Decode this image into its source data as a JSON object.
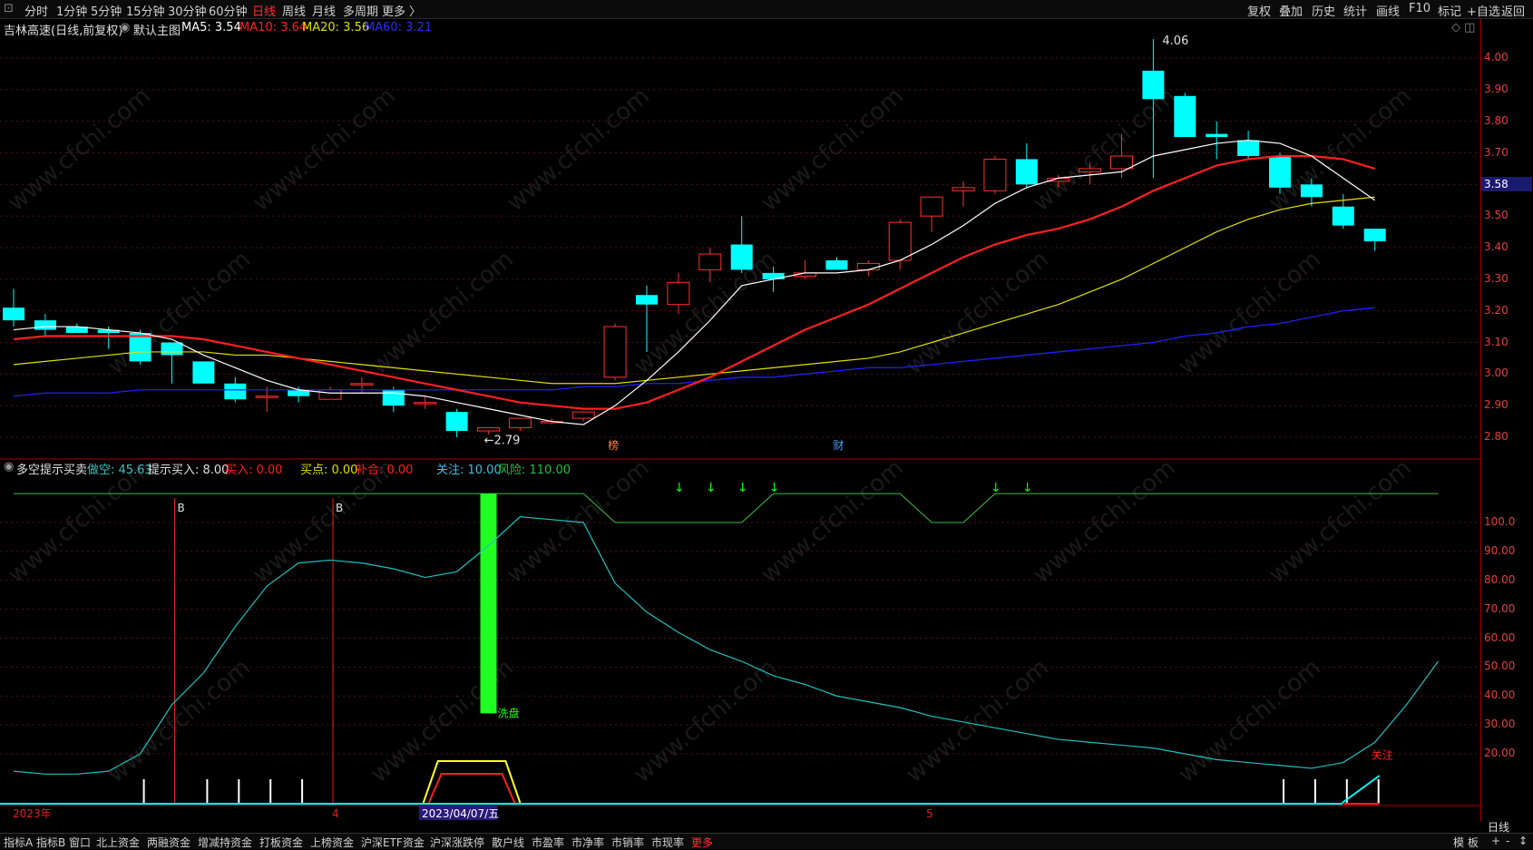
{
  "topbar": {
    "window_glyph": "⊡",
    "periods": [
      "分时",
      "1分钟",
      "5分钟",
      "15分钟",
      "30分钟",
      "60分钟",
      "日线",
      "周线",
      "月线",
      "多周期",
      "更多 〉"
    ],
    "right_buttons": [
      "复权",
      "叠加",
      "历史",
      "统计",
      "画线",
      "F10",
      "标记",
      "+自选",
      "返回"
    ]
  },
  "main_header": {
    "stock": "吉林高速(日线,前复权)",
    "chart_name": "默认主图",
    "ma5": "MA5: 3.54",
    "ma10": "MA10: 3.64",
    "ma20": "MA20: 3.56",
    "ma60": "MA60: 3.21"
  },
  "sub_header": {
    "indicator": "多空提示买卖",
    "zuokong": "做空: 45.63",
    "tishi": "提示买入: 8.00",
    "mairu": "买入: 0.00",
    "maidian": "买点: 0.00",
    "buhe": "补合: 0.00",
    "guanzhu": "关注: 10.00",
    "fengxian": "风险: 110.00"
  },
  "axis": {
    "price_ticks": [
      "4.00",
      "3.90",
      "3.80",
      "3.70",
      "3.60",
      "3.50",
      "3.40",
      "3.30",
      "3.20",
      "3.10",
      "3.00",
      "2.90",
      "2.80"
    ],
    "indicator_ticks": [
      "100.0",
      "90.00",
      "80.00",
      "70.00",
      "60.00",
      "50.00",
      "40.00",
      "30.00",
      "20.00"
    ],
    "current_price": "3.58",
    "period_label": "日线"
  },
  "annotations": {
    "high": "4.06",
    "low": "←2.79",
    "bang": "榜",
    "cai": "财",
    "b1": "B",
    "b2": "B",
    "xipan": "洗盘",
    "guanzhu": "关注",
    "date_2023": "2023年",
    "month4": "4",
    "date_cursor": "2023/04/07/五",
    "month5": "5"
  },
  "bottombar": {
    "tabs": [
      "指标A",
      "指标B",
      "窗口",
      "北上资金",
      "两融资金",
      "增减持资金",
      "打板资金",
      "上榜资金",
      "沪深ETF资金",
      "沪深涨跌停",
      "散户线",
      "市盈率",
      "市净率",
      "市销率",
      "市现率",
      "更多"
    ],
    "right": [
      "模 板",
      "+",
      "-",
      "↕"
    ]
  },
  "watermark": "www.cfchi.com",
  "colors": {
    "up": "#ff3030",
    "down": "#00ffff",
    "ma5": "#ffffff",
    "ma10": "#ff2020",
    "ma20": "#e0e000",
    "ma60": "#2020ff",
    "signal": "#00ff00"
  },
  "chart_data": {
    "type": "candlestick",
    "ylim": [
      2.75,
      4.1
    ],
    "candles": [
      {
        "o": 3.21,
        "h": 3.27,
        "l": 3.15,
        "c": 3.17
      },
      {
        "o": 3.17,
        "h": 3.19,
        "l": 3.12,
        "c": 3.14
      },
      {
        "o": 3.15,
        "h": 3.16,
        "l": 3.13,
        "c": 3.13
      },
      {
        "o": 3.14,
        "h": 3.15,
        "l": 3.08,
        "c": 3.13
      },
      {
        "o": 3.13,
        "h": 3.14,
        "l": 3.03,
        "c": 3.04
      },
      {
        "o": 3.1,
        "h": 3.1,
        "l": 2.97,
        "c": 3.06
      },
      {
        "o": 3.04,
        "h": 3.04,
        "l": 2.97,
        "c": 2.97
      },
      {
        "o": 2.97,
        "h": 2.99,
        "l": 2.91,
        "c": 2.92
      },
      {
        "o": 2.93,
        "h": 2.96,
        "l": 2.88,
        "c": 2.93
      },
      {
        "o": 2.95,
        "h": 2.96,
        "l": 2.91,
        "c": 2.93
      },
      {
        "o": 2.92,
        "h": 2.96,
        "l": 2.92,
        "c": 2.95
      },
      {
        "o": 2.97,
        "h": 2.99,
        "l": 2.94,
        "c": 2.97
      },
      {
        "o": 2.95,
        "h": 2.96,
        "l": 2.88,
        "c": 2.9
      },
      {
        "o": 2.91,
        "h": 2.93,
        "l": 2.89,
        "c": 2.91
      },
      {
        "o": 2.88,
        "h": 2.89,
        "l": 2.8,
        "c": 2.82
      },
      {
        "o": 2.82,
        "h": 2.83,
        "l": 2.81,
        "c": 2.83
      },
      {
        "o": 2.83,
        "h": 2.86,
        "l": 2.82,
        "c": 2.86
      },
      {
        "o": 2.85,
        "h": 2.86,
        "l": 2.84,
        "c": 2.85
      },
      {
        "o": 2.86,
        "h": 2.88,
        "l": 2.85,
        "c": 2.88
      },
      {
        "o": 2.99,
        "h": 3.16,
        "l": 2.98,
        "c": 3.15
      },
      {
        "o": 3.25,
        "h": 3.28,
        "l": 3.07,
        "c": 3.22
      },
      {
        "o": 3.22,
        "h": 3.32,
        "l": 3.19,
        "c": 3.29
      },
      {
        "o": 3.33,
        "h": 3.4,
        "l": 3.29,
        "c": 3.38
      },
      {
        "o": 3.41,
        "h": 3.5,
        "l": 3.32,
        "c": 3.33
      },
      {
        "o": 3.32,
        "h": 3.34,
        "l": 3.26,
        "c": 3.3
      },
      {
        "o": 3.31,
        "h": 3.36,
        "l": 3.3,
        "c": 3.32
      },
      {
        "o": 3.36,
        "h": 3.37,
        "l": 3.33,
        "c": 3.33
      },
      {
        "o": 3.33,
        "h": 3.36,
        "l": 3.31,
        "c": 3.35
      },
      {
        "o": 3.36,
        "h": 3.49,
        "l": 3.33,
        "c": 3.48
      },
      {
        "o": 3.5,
        "h": 3.56,
        "l": 3.45,
        "c": 3.56
      },
      {
        "o": 3.58,
        "h": 3.61,
        "l": 3.53,
        "c": 3.59
      },
      {
        "o": 3.58,
        "h": 3.69,
        "l": 3.57,
        "c": 3.68
      },
      {
        "o": 3.68,
        "h": 3.73,
        "l": 3.59,
        "c": 3.6
      },
      {
        "o": 3.61,
        "h": 3.63,
        "l": 3.59,
        "c": 3.62
      },
      {
        "o": 3.64,
        "h": 3.67,
        "l": 3.6,
        "c": 3.65
      },
      {
        "o": 3.65,
        "h": 3.76,
        "l": 3.62,
        "c": 3.69
      },
      {
        "o": 3.96,
        "h": 4.06,
        "l": 3.62,
        "c": 3.87
      },
      {
        "o": 3.88,
        "h": 3.89,
        "l": 3.76,
        "c": 3.75
      },
      {
        "o": 3.76,
        "h": 3.8,
        "l": 3.68,
        "c": 3.75
      },
      {
        "o": 3.74,
        "h": 3.77,
        "l": 3.68,
        "c": 3.69
      },
      {
        "o": 3.69,
        "h": 3.7,
        "l": 3.57,
        "c": 3.59
      },
      {
        "o": 3.6,
        "h": 3.62,
        "l": 3.53,
        "c": 3.56
      },
      {
        "o": 3.53,
        "h": 3.57,
        "l": 3.46,
        "c": 3.47
      },
      {
        "o": 3.46,
        "h": 3.46,
        "l": 3.39,
        "c": 3.42
      }
    ],
    "ma5": [
      3.14,
      3.15,
      3.15,
      3.14,
      3.13,
      3.11,
      3.06,
      3.02,
      2.98,
      2.95,
      2.94,
      2.94,
      2.94,
      2.93,
      2.91,
      2.89,
      2.87,
      2.85,
      2.84,
      2.9,
      2.98,
      3.07,
      3.17,
      3.28,
      3.3,
      3.32,
      3.32,
      3.33,
      3.36,
      3.41,
      3.47,
      3.54,
      3.59,
      3.62,
      3.63,
      3.64,
      3.69,
      3.71,
      3.73,
      3.74,
      3.73,
      3.69,
      3.62,
      3.55
    ],
    "ma10": [
      3.11,
      3.12,
      3.12,
      3.12,
      3.12,
      3.12,
      3.11,
      3.09,
      3.07,
      3.05,
      3.03,
      3.01,
      2.99,
      2.97,
      2.95,
      2.93,
      2.91,
      2.9,
      2.89,
      2.89,
      2.91,
      2.95,
      2.99,
      3.04,
      3.09,
      3.14,
      3.18,
      3.22,
      3.27,
      3.32,
      3.37,
      3.41,
      3.44,
      3.46,
      3.49,
      3.53,
      3.58,
      3.62,
      3.66,
      3.68,
      3.69,
      3.69,
      3.68,
      3.65
    ],
    "ma20": [
      3.03,
      3.04,
      3.05,
      3.06,
      3.07,
      3.07,
      3.07,
      3.06,
      3.06,
      3.05,
      3.04,
      3.03,
      3.02,
      3.01,
      3.0,
      2.99,
      2.98,
      2.97,
      2.97,
      2.97,
      2.98,
      2.99,
      3.0,
      3.01,
      3.02,
      3.03,
      3.04,
      3.05,
      3.07,
      3.1,
      3.13,
      3.16,
      3.19,
      3.22,
      3.26,
      3.3,
      3.35,
      3.4,
      3.45,
      3.49,
      3.52,
      3.54,
      3.55,
      3.56
    ],
    "ma60": [
      2.93,
      2.94,
      2.94,
      2.94,
      2.95,
      2.95,
      2.95,
      2.95,
      2.95,
      2.95,
      2.95,
      2.95,
      2.95,
      2.95,
      2.95,
      2.95,
      2.95,
      2.95,
      2.96,
      2.96,
      2.97,
      2.97,
      2.98,
      2.99,
      2.99,
      3.0,
      3.01,
      3.02,
      3.02,
      3.03,
      3.04,
      3.05,
      3.06,
      3.07,
      3.08,
      3.09,
      3.1,
      3.12,
      3.13,
      3.15,
      3.16,
      3.18,
      3.2,
      3.21
    ],
    "indicator": {
      "ylim": [
        0,
        110
      ],
      "line": [
        14,
        13,
        13,
        14,
        20,
        37,
        48,
        64,
        78,
        86,
        87,
        86,
        84,
        81,
        83,
        92,
        102,
        101,
        100,
        79,
        69,
        62,
        56,
        52,
        47,
        44,
        40,
        38,
        36,
        33,
        31,
        29,
        27,
        25,
        24,
        23,
        22,
        20,
        18,
        17,
        16,
        15,
        17,
        24,
        37,
        52
      ],
      "risk_base": 110,
      "risk_dips": [
        19,
        20,
        21,
        22,
        23,
        29,
        30
      ],
      "risk_dip_value": 100,
      "arrows": [
        20,
        21,
        22,
        23,
        30,
        31
      ],
      "b_signals": [
        5,
        10
      ],
      "tick_bars": [
        4,
        6,
        7,
        8,
        9,
        40,
        41,
        42,
        43
      ],
      "green_bar": {
        "index": 15,
        "top": 110,
        "bottom": 34
      },
      "trapezoid": {
        "start": 13,
        "end": 16
      }
    }
  }
}
